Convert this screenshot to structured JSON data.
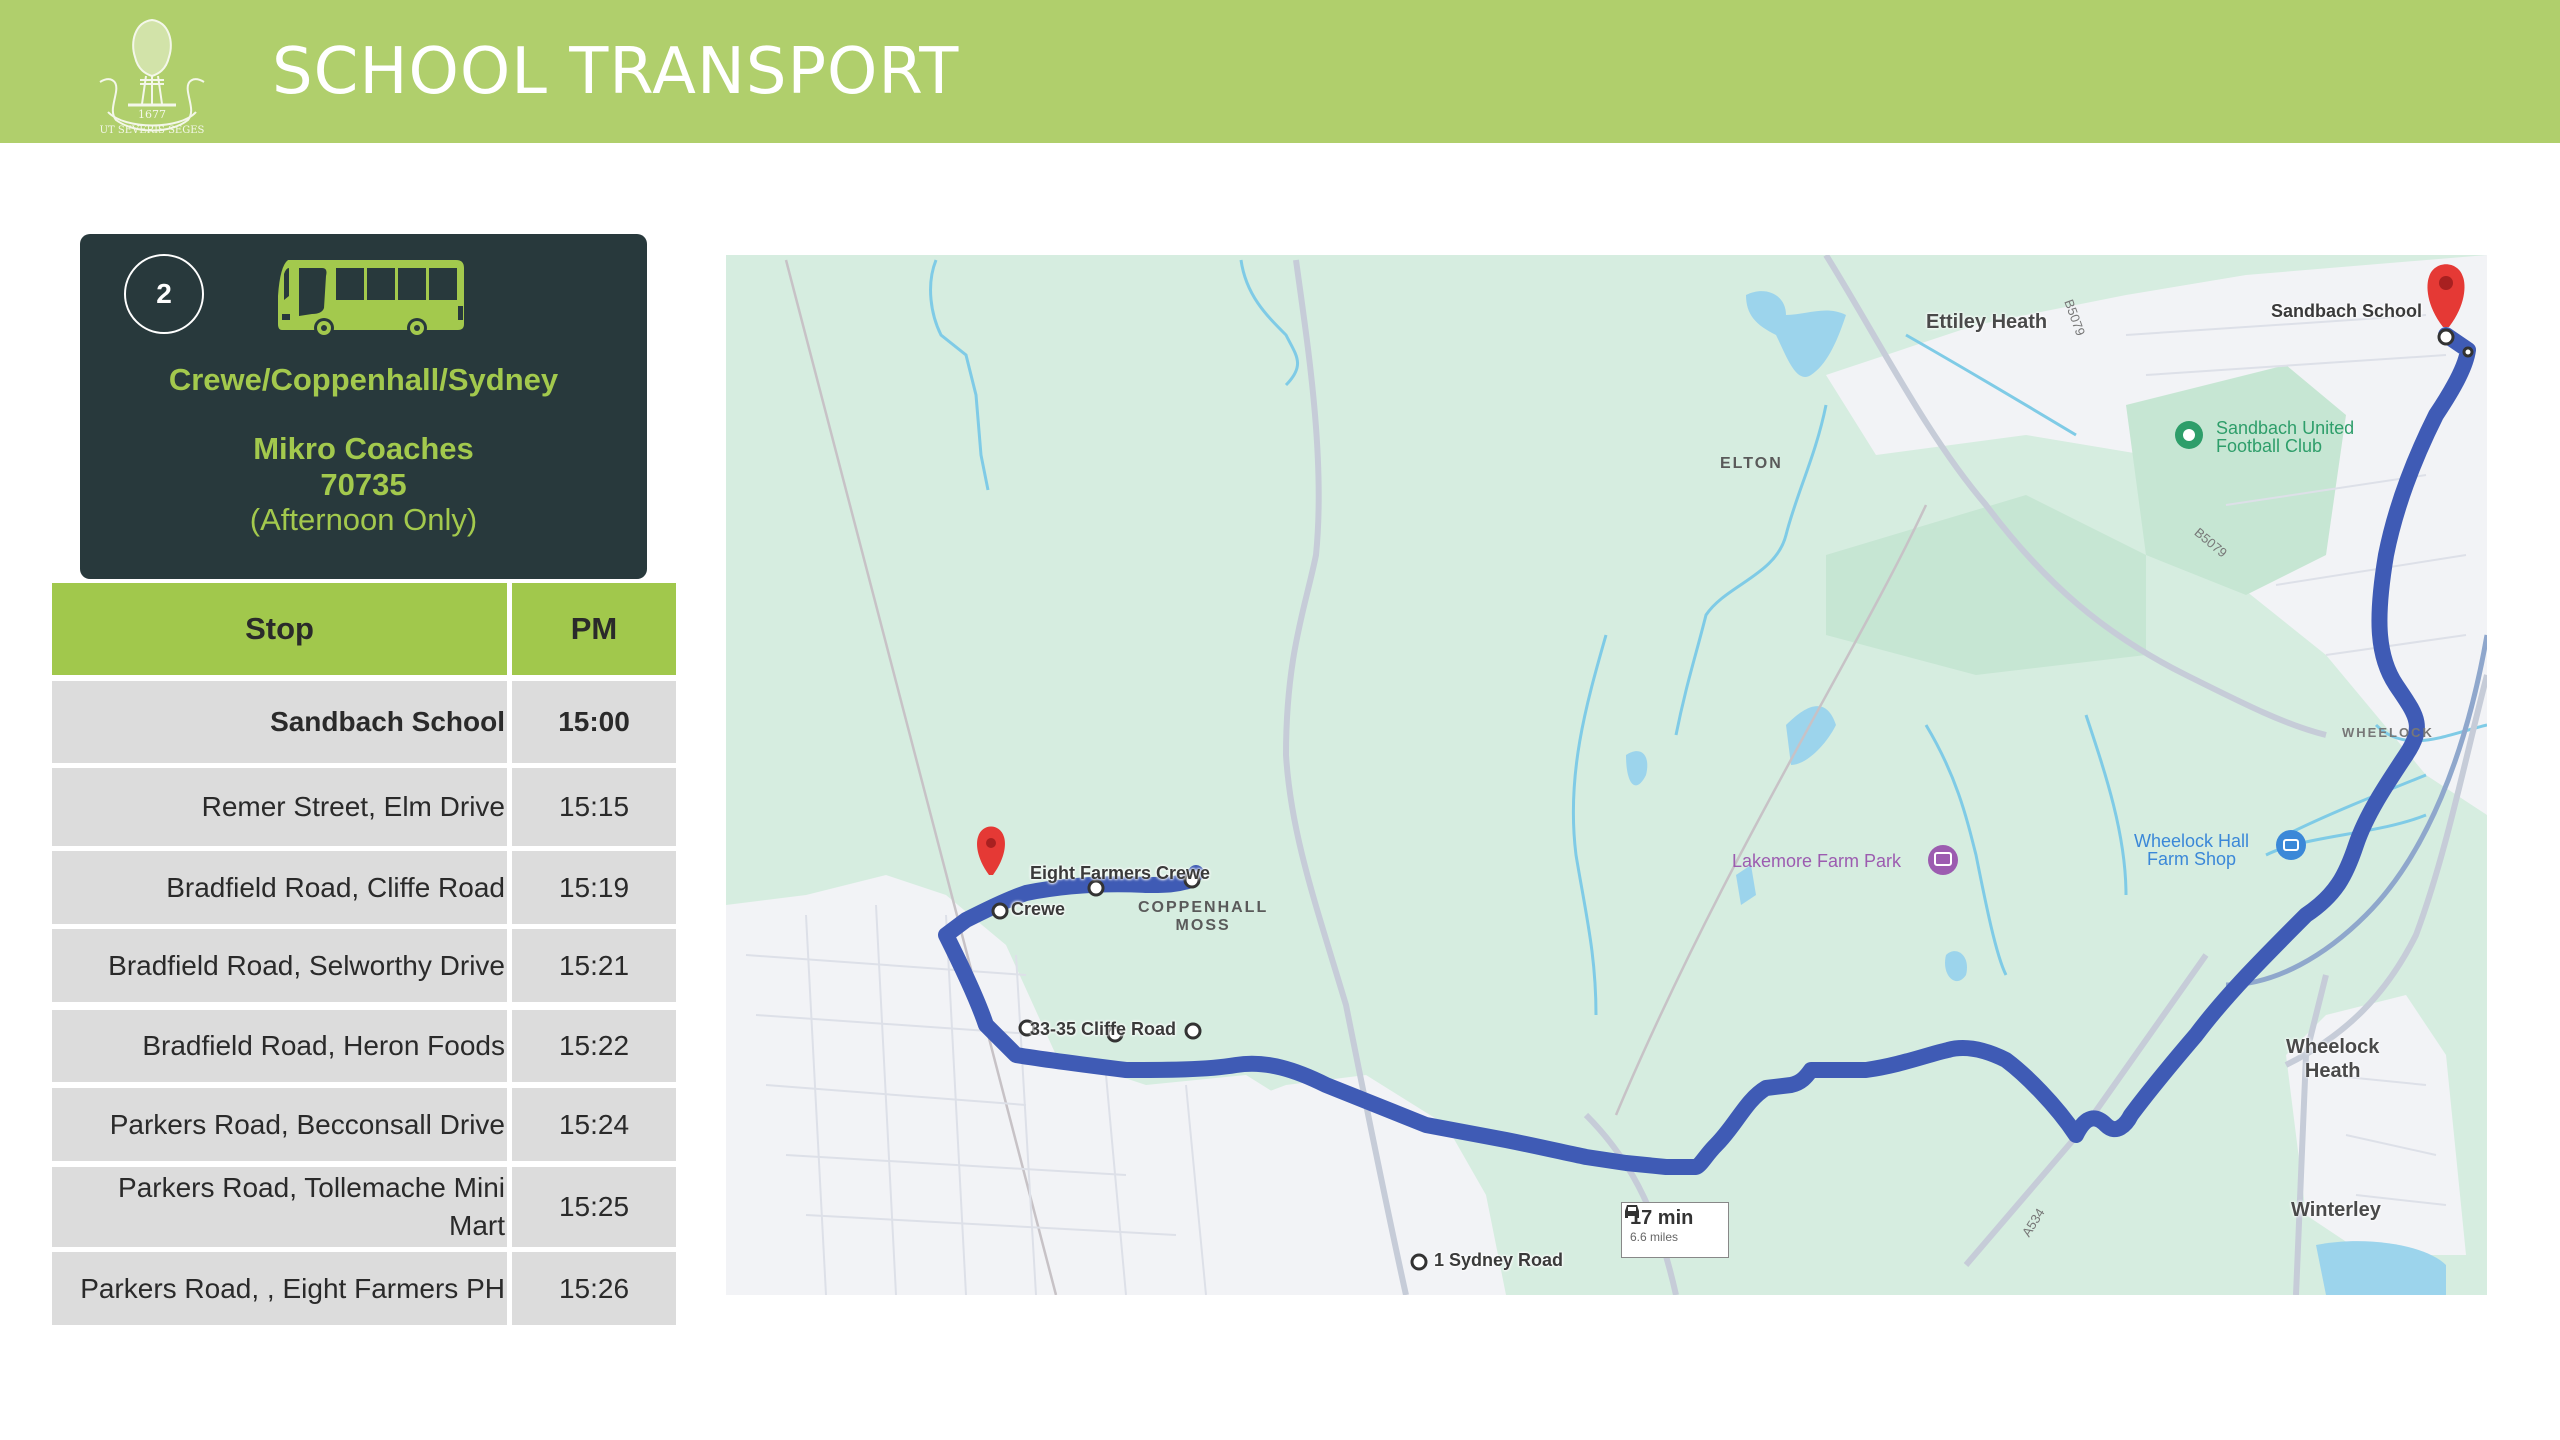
{
  "header": {
    "title": "SCHOOL TRANSPORT",
    "crest": {
      "year": "1677",
      "motto": "UT SEVERIS SEGES"
    },
    "color": "#b0cf6c"
  },
  "route_card": {
    "route_number": "2",
    "route_name": "Crewe/Coppenhall/Sydney",
    "operator": "Mikro Coaches",
    "service_number": "70735",
    "note": "(Afternoon Only)",
    "icon": "bus-icon",
    "accent": "#a3c94d",
    "background": "#28393c"
  },
  "timetable": {
    "columns": [
      "Stop",
      "PM"
    ],
    "rows": [
      {
        "stop": "Sandbach School",
        "pm": "15:00",
        "bold": true
      },
      {
        "stop": "Remer Street, Elm Drive",
        "pm": "15:15"
      },
      {
        "stop": "Bradfield Road, Cliffe Road",
        "pm": "15:19"
      },
      {
        "stop": "Bradfield Road, Selworthy Drive",
        "pm": "15:21"
      },
      {
        "stop": "Bradfield Road, Heron Foods",
        "pm": "15:22"
      },
      {
        "stop": "Parkers Road, Becconsall Drive",
        "pm": "15:24"
      },
      {
        "stop": "Parkers Road, Tollemache Mini Mart",
        "pm": "15:25"
      },
      {
        "stop": "Parkers Road, , Eight Farmers PH",
        "pm": "15:26"
      }
    ]
  },
  "map": {
    "places": {
      "ettiley_heath": "Ettiley Heath",
      "elton": "ELTON",
      "coppenhall_moss_1": "COPPENHALL",
      "coppenhall_moss_2": "MOSS",
      "wheelock": "WHEELOCK",
      "wheelock_heath_1": "Wheelock",
      "wheelock_heath_2": "Heath",
      "winterley": "Winterley"
    },
    "pois": {
      "football_1": "Sandbach United",
      "football_2": "Football Club",
      "farm_park": "Lakemore Farm Park",
      "farm_shop_1": "Wheelock Hall",
      "farm_shop_2": "Farm Shop"
    },
    "stops": {
      "school": "Sandbach School",
      "eight_farmers": "Eight Farmers Crewe",
      "crewe": "Crewe",
      "cliffe_road": "33-35 Cliffe Road",
      "sydney_road": "1 Sydney Road"
    },
    "roads": {
      "b5079_a": "B5079",
      "b5079_b": "B5079",
      "a534": "A534"
    },
    "eta": {
      "time": "17 min",
      "distance": "6.6 miles"
    },
    "route_color": "#3f5bb5"
  }
}
